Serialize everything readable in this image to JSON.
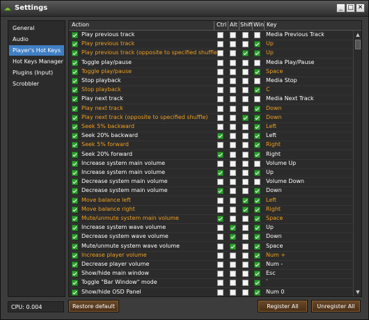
{
  "window": {
    "title": "Settings"
  },
  "sidebar": {
    "items": [
      {
        "label": "General"
      },
      {
        "label": "Audio"
      },
      {
        "label": "Player's Hot Keys"
      },
      {
        "label": "Hot Keys Manager"
      },
      {
        "label": "Plugins (Input)"
      },
      {
        "label": "Scrobbler"
      }
    ],
    "selected": "Player's Hot Keys"
  },
  "table": {
    "headers": {
      "action": "Action",
      "ctrl": "Ctrl",
      "alt": "Alt",
      "shift": "Shift",
      "win": "Win",
      "key": "Key"
    },
    "rows": [
      {
        "action": "Play previous track",
        "ctrl": false,
        "alt": false,
        "shift": false,
        "win": false,
        "key": "Media Previous Track",
        "highlight": false
      },
      {
        "action": "Play previous track",
        "ctrl": false,
        "alt": false,
        "shift": false,
        "win": true,
        "key": "Up",
        "highlight": true
      },
      {
        "action": "Play previous track (opposite to specified shuffle)",
        "ctrl": false,
        "alt": false,
        "shift": true,
        "win": true,
        "key": "Up",
        "highlight": true
      },
      {
        "action": "Toggle play/pause",
        "ctrl": false,
        "alt": false,
        "shift": false,
        "win": false,
        "key": "Media Play/Pause",
        "highlight": false
      },
      {
        "action": "Toggle play/pause",
        "ctrl": false,
        "alt": false,
        "shift": false,
        "win": true,
        "key": "Space",
        "highlight": true
      },
      {
        "action": "Stop playback",
        "ctrl": false,
        "alt": false,
        "shift": false,
        "win": false,
        "key": "Media Stop",
        "highlight": false
      },
      {
        "action": "Stop playback",
        "ctrl": false,
        "alt": false,
        "shift": false,
        "win": true,
        "key": "C",
        "highlight": true
      },
      {
        "action": "Play next track",
        "ctrl": false,
        "alt": false,
        "shift": false,
        "win": false,
        "key": "Media Next Track",
        "highlight": false
      },
      {
        "action": "Play next track",
        "ctrl": false,
        "alt": false,
        "shift": false,
        "win": true,
        "key": "Down",
        "highlight": true
      },
      {
        "action": "Play next track (opposite to specified shuffle)",
        "ctrl": false,
        "alt": false,
        "shift": true,
        "win": true,
        "key": "Down",
        "highlight": true
      },
      {
        "action": "Seek 5% backward",
        "ctrl": false,
        "alt": false,
        "shift": false,
        "win": true,
        "key": "Left",
        "highlight": true
      },
      {
        "action": "Seek 20% backward",
        "ctrl": true,
        "alt": false,
        "shift": false,
        "win": true,
        "key": "Left",
        "highlight": false
      },
      {
        "action": "Seek 5% forward",
        "ctrl": false,
        "alt": false,
        "shift": false,
        "win": true,
        "key": "Right",
        "highlight": true
      },
      {
        "action": "Seek 20% forward",
        "ctrl": true,
        "alt": false,
        "shift": false,
        "win": true,
        "key": "Right",
        "highlight": false
      },
      {
        "action": "Increase system main volume",
        "ctrl": false,
        "alt": false,
        "shift": false,
        "win": false,
        "key": "Volume Up",
        "highlight": false
      },
      {
        "action": "Increase system main volume",
        "ctrl": true,
        "alt": false,
        "shift": false,
        "win": true,
        "key": "Up",
        "highlight": false
      },
      {
        "action": "Decrease system main volume",
        "ctrl": false,
        "alt": false,
        "shift": false,
        "win": false,
        "key": "Volume Down",
        "highlight": false
      },
      {
        "action": "Decrease system main volume",
        "ctrl": true,
        "alt": false,
        "shift": false,
        "win": true,
        "key": "Down",
        "highlight": false
      },
      {
        "action": "Move balance left",
        "ctrl": false,
        "alt": false,
        "shift": true,
        "win": true,
        "key": "Left",
        "highlight": true
      },
      {
        "action": "Move balance right",
        "ctrl": false,
        "alt": false,
        "shift": true,
        "win": true,
        "key": "Right",
        "highlight": true
      },
      {
        "action": "Mute/unmute system main volume",
        "ctrl": true,
        "alt": false,
        "shift": false,
        "win": true,
        "key": "Space",
        "highlight": true
      },
      {
        "action": "Increase system wave volume",
        "ctrl": false,
        "alt": true,
        "shift": false,
        "win": true,
        "key": "Up",
        "highlight": false
      },
      {
        "action": "Decrease system wave volume",
        "ctrl": false,
        "alt": true,
        "shift": false,
        "win": true,
        "key": "Down",
        "highlight": false
      },
      {
        "action": "Mute/unmute system wave volume",
        "ctrl": false,
        "alt": true,
        "shift": false,
        "win": true,
        "key": "Space",
        "highlight": false
      },
      {
        "action": "Increase player volume",
        "ctrl": false,
        "alt": false,
        "shift": false,
        "win": true,
        "key": "Num +",
        "highlight": true
      },
      {
        "action": "Decrease player volume",
        "ctrl": false,
        "alt": false,
        "shift": false,
        "win": true,
        "key": "Num -",
        "highlight": false
      },
      {
        "action": "Show/hide main window",
        "ctrl": false,
        "alt": false,
        "shift": false,
        "win": true,
        "key": "Esc",
        "highlight": false
      },
      {
        "action": "Toggle \"Bar Window\" mode",
        "ctrl": false,
        "alt": false,
        "shift": false,
        "win": true,
        "key": "`",
        "highlight": false
      },
      {
        "action": "Show/hide OSD Panel",
        "ctrl": false,
        "alt": false,
        "shift": false,
        "win": true,
        "key": "Num 0",
        "highlight": false
      }
    ]
  },
  "status": {
    "cpu": "CPU: 0.004"
  },
  "buttons": {
    "restore_default": "Restore default",
    "register_all": "Register All",
    "unregister_all": "Unregister All"
  },
  "icons": {
    "app": "app-icon",
    "minimize": "minimize-icon",
    "maximize": "maximize-icon",
    "close": "close-icon"
  },
  "colors": {
    "highlight_text": "#f0a020",
    "checked": "#2ea12e",
    "selection": "#3f7fc4"
  }
}
